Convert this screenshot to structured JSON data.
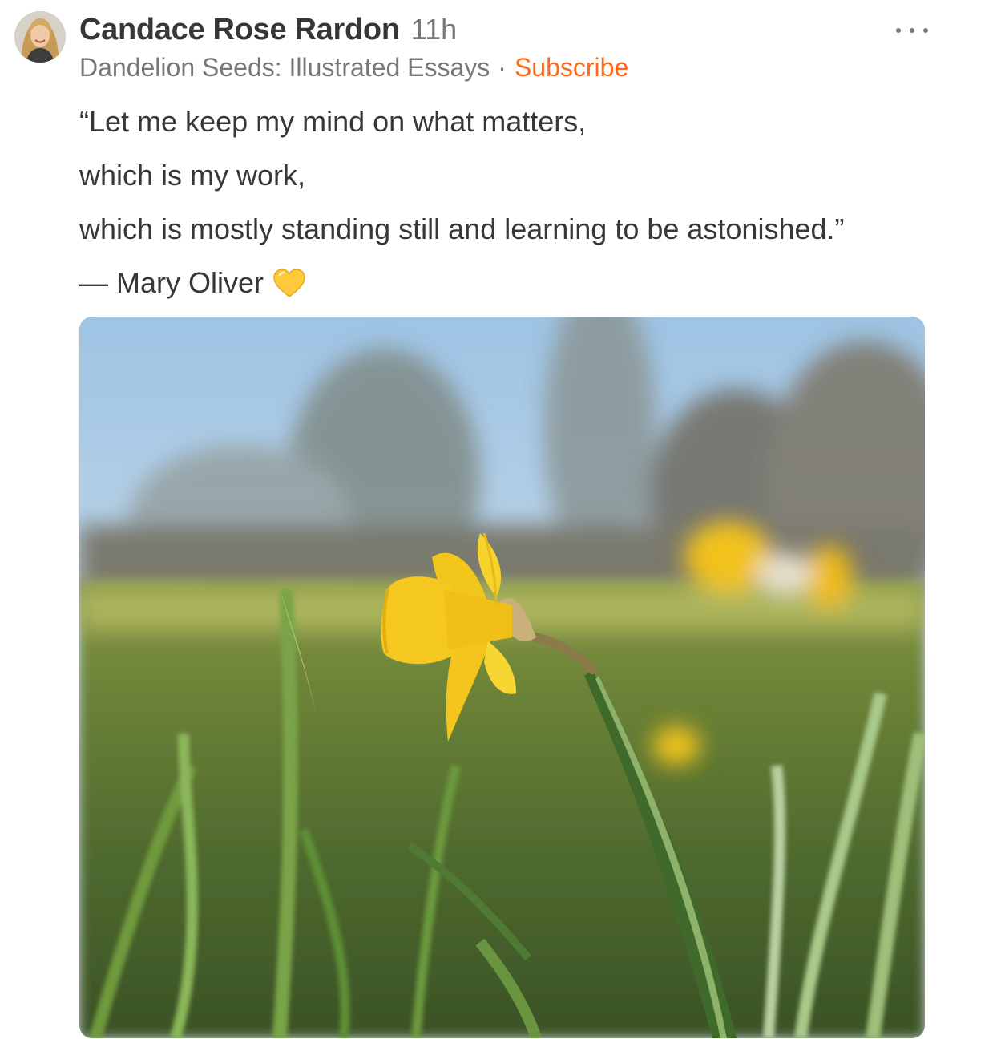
{
  "post": {
    "author": "Candace Rose Rardon",
    "timestamp": "11h",
    "publication": "Dandelion Seeds: Illustrated Essays",
    "separator": "·",
    "subscribe_label": "Subscribe",
    "lines": [
      "“Let me keep my mind on what matters,",
      "which is my work,",
      "which is mostly standing still and learning to be astonished.”",
      "— Mary Oliver"
    ],
    "emoji": "yellow-heart"
  },
  "icons": {
    "more": "more-horizontal-icon",
    "heart": "yellow-heart-icon"
  },
  "colors": {
    "accent": "#ff6719",
    "text": "#363737",
    "muted": "#777777",
    "heart": "#ffc93c"
  }
}
